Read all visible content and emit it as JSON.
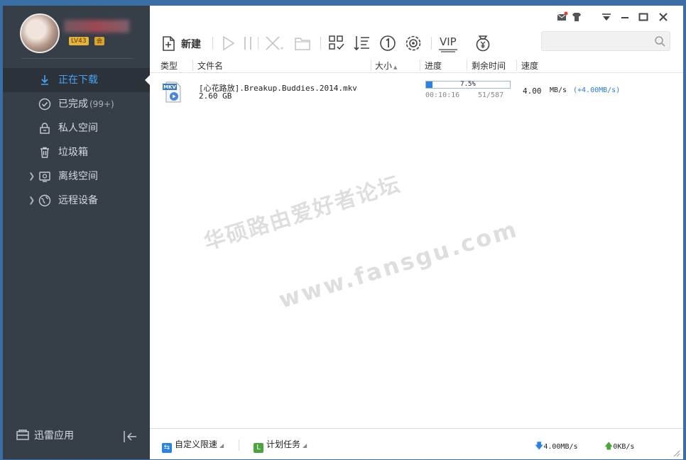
{
  "sidebar": {
    "level": "LV43",
    "vip_badge": "会",
    "items": [
      {
        "label": "正在下载",
        "count": ""
      },
      {
        "label": "已完成",
        "count": "(99+)"
      },
      {
        "label": "私人空间",
        "count": ""
      },
      {
        "label": "垃圾箱",
        "count": ""
      },
      {
        "label": "离线空间",
        "count": ""
      },
      {
        "label": "远程设备",
        "count": ""
      }
    ],
    "footer_label": "迅雷应用"
  },
  "toolbar": {
    "new_label": "新建",
    "vip_label": "VIP"
  },
  "columns": {
    "type": "类型",
    "name": "文件名",
    "size": "大小",
    "progress": "进度",
    "remaining": "剩余时间",
    "speed": "速度"
  },
  "download": {
    "file_icon_label": "MKV",
    "name": "[心花路放].Breakup.Buddies.2014.mkv",
    "size": "2.60 GB",
    "progress_text": "7.5%",
    "progress_fraction": 0.075,
    "elapsed": "00:10:16",
    "pieces": "51/587",
    "speed": "4.00",
    "speed_unit": "MB/s",
    "speed_boost": "(+4.00MB/s)"
  },
  "watermark": {
    "line1": "华硕路由爱好者论坛",
    "line2": "www.fansgu.com"
  },
  "statusbar": {
    "speed_limit_label": "自定义限速",
    "schedule_label": "计划任务",
    "download_speed": "4.00MB/s",
    "upload_speed": "0KB/s"
  },
  "colors": {
    "sidebar_bg": "#363e48",
    "accent": "#2a82e4",
    "active_nav_text": "#4aa3f0"
  }
}
